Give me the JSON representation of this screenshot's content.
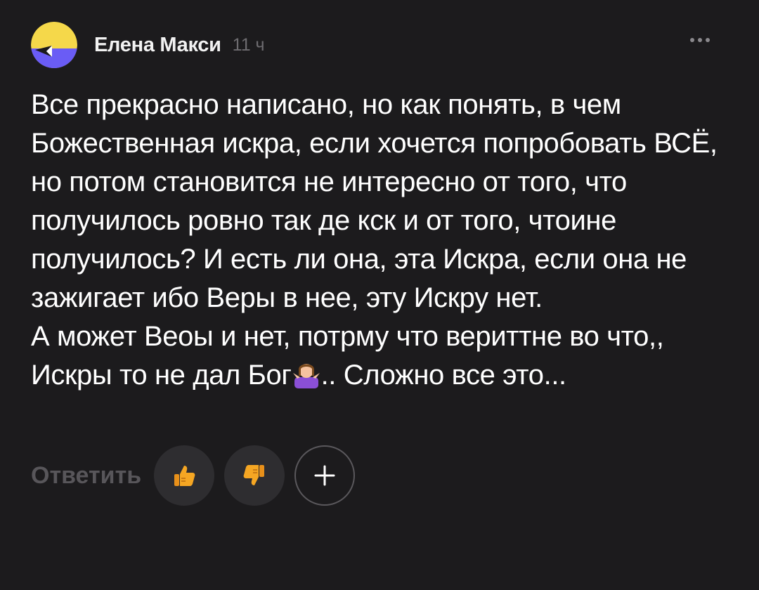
{
  "comment": {
    "author": "Елена Макси",
    "time": "11 ч",
    "paragraphs": [
      "Все прекрасно написано, но как понять, в чем Божественная искра, если хочется попробовать ВСЁ, но потом становится не интересно от того, что получилось ровно так де кск и от того, чтоине получилось? И есть ли она, эта Искра, если она не зажигает ибо Веры в нее, эту Искру нет."
    ],
    "last_before_emoji": "А может Веоы и нет, потрму что вериттне во что,, Искры то не дал Бог",
    "last_after_emoji": ".. Сложно все это..."
  },
  "actions": {
    "reply_label": "Ответить"
  },
  "icons": {
    "avatar": "avatar-icon",
    "more": "more-dots-icon",
    "like": "thumbs-up-icon",
    "dislike": "thumbs-down-icon",
    "add": "plus-icon",
    "emoji": "person-shrugging-emoji"
  },
  "colors": {
    "background": "#1c1b1d",
    "avatar_yellow": "#f5d84a",
    "avatar_purple": "#6a5cf5",
    "muted_text": "#6e6c70",
    "button_bg": "#2e2d30",
    "thumb_orange": "#f5a623"
  }
}
